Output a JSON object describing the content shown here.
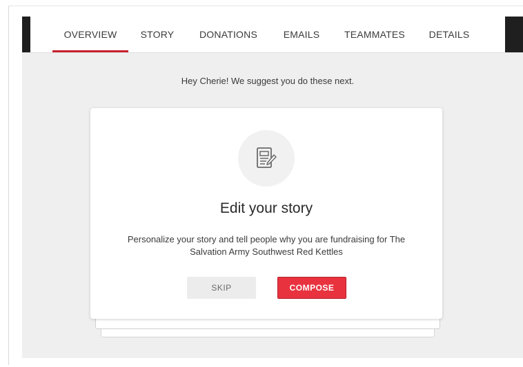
{
  "tabs": [
    {
      "label": "OVERVIEW"
    },
    {
      "label": "STORY"
    },
    {
      "label": "DONATIONS"
    },
    {
      "label": "EMAILS"
    },
    {
      "label": "TEAMMATES"
    },
    {
      "label": "DETAILS"
    }
  ],
  "active_tab": "OVERVIEW",
  "suggestion": "Hey Cherie! We suggest you do these next.",
  "card": {
    "icon": "edit-story-icon",
    "title": "Edit your story",
    "description": "Personalize your story and tell people why you are fundraising for The Salvation Army Southwest Red Kettles",
    "skip_label": "SKIP",
    "compose_label": "COMPOSE"
  },
  "colors": {
    "accent": "#c8202f",
    "compose_button": "#e8333f",
    "background": "#efefef"
  }
}
